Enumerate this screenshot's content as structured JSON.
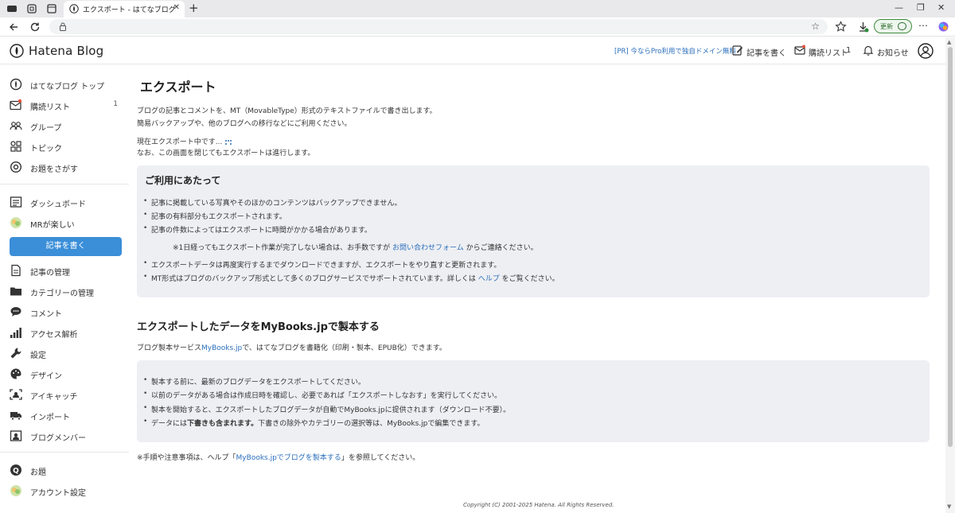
{
  "browser": {
    "tab_title": "エクスポート - はてなブログ",
    "update_label": "更新"
  },
  "header": {
    "logo_text": "Hatena Blog",
    "pr_link": "[PR] 今ならPro利用で独自ドメイン無料",
    "write_label": "記事を書く",
    "reading_list_label": "購読リスト",
    "reading_list_count": "1",
    "notifications_label": "お知らせ"
  },
  "sidebar": {
    "items_top": [
      {
        "label": "はてなブログ トップ",
        "icon": "hatena-icon"
      },
      {
        "label": "購読リスト",
        "count": "1",
        "icon": "mail-icon"
      },
      {
        "label": "グループ",
        "icon": "group-icon"
      },
      {
        "label": "トピック",
        "icon": "topic-icon"
      },
      {
        "label": "お題をさがす",
        "icon": "at-icon"
      }
    ],
    "dashboard": "ダッシュボード",
    "blog_name": "MRが楽しい",
    "write_button": "記事を書く",
    "items_manage": [
      {
        "label": "記事の管理",
        "icon": "document-icon"
      },
      {
        "label": "カテゴリーの管理",
        "icon": "folder-icon"
      },
      {
        "label": "コメント",
        "icon": "comment-icon"
      },
      {
        "label": "アクセス解析",
        "icon": "bar-chart-icon"
      },
      {
        "label": "設定",
        "icon": "wrench-icon"
      },
      {
        "label": "デザイン",
        "icon": "palette-icon"
      },
      {
        "label": "アイキャッチ",
        "icon": "eyecatch-icon"
      },
      {
        "label": "インポート",
        "icon": "truck-icon"
      },
      {
        "label": "ブログメンバー",
        "icon": "member-icon"
      }
    ],
    "items_bottom": [
      {
        "label": "お題",
        "icon": "odai-icon"
      },
      {
        "label": "アカウント設定",
        "icon": "account-icon"
      }
    ]
  },
  "main": {
    "title": "エクスポート",
    "intro_line1": "ブログの記事とコメントを、MT（MovableType）形式のテキストファイルで書き出します。",
    "intro_line2": "簡易バックアップや、他のブログへの移行などにご利用ください。",
    "status_line1": "現在エクスポート中です...",
    "status_line2": "なお、この画面を閉じてもエクスポートは進行します。",
    "notice": {
      "title": "ご利用にあたって",
      "item1": "記事に掲載している写真やそのほかのコンテンツはバックアップできません。",
      "item2": "記事の有料部分もエクスポートされます。",
      "item3": "記事の件数によってはエクスポートに時間がかかる場合があります。",
      "item3_sub_before": "※1日経ってもエクスポート作業が完了しない場合は、お手数ですが ",
      "item3_sub_link": "お問い合わせフォーム",
      "item3_sub_after": " からご連絡ください。",
      "item4": "エクスポートデータは再度実行するまでダウンロードできますが、エクスポートをやり直すと更新されます。",
      "item5_before": "MT形式はブログのバックアップ形式として多くのブログサービスでサポートされています。詳しくは ",
      "item5_link": "ヘルプ",
      "item5_after": " をご覧ください。"
    },
    "mybooks": {
      "title": "エクスポートしたデータをMyBooks.jpで製本する",
      "desc_before": "ブログ製本サービス",
      "desc_link": "MyBooks.jp",
      "desc_after": "で、はてなブログを書籍化（印刷・製本、EPUB化）できます。",
      "item1": "製本する前に、最新のブログデータをエクスポートしてください。",
      "item2": "以前のデータがある場合は作成日時を確認し、必要であれば「エクスポートしなおす」を実行してください。",
      "item3": "製本を開始すると、エクスポートしたブログデータが自動でMyBooks.jpに提供されます（ダウンロード不要）。",
      "item4_pre": "データには",
      "item4_bold": "下書きも含まれます。",
      "item4_post": "下書きの除外やカテゴリーの選択等は、MyBooks.jpで編集できます。",
      "footnote_before": "※手順や注意事項は、ヘルプ「",
      "footnote_link": "MyBooks.jpでブログを製本する",
      "footnote_after": "」を参照してください。"
    },
    "copyright": "Copyright (C) 2001-2025 Hatena. All Rights Reserved."
  }
}
